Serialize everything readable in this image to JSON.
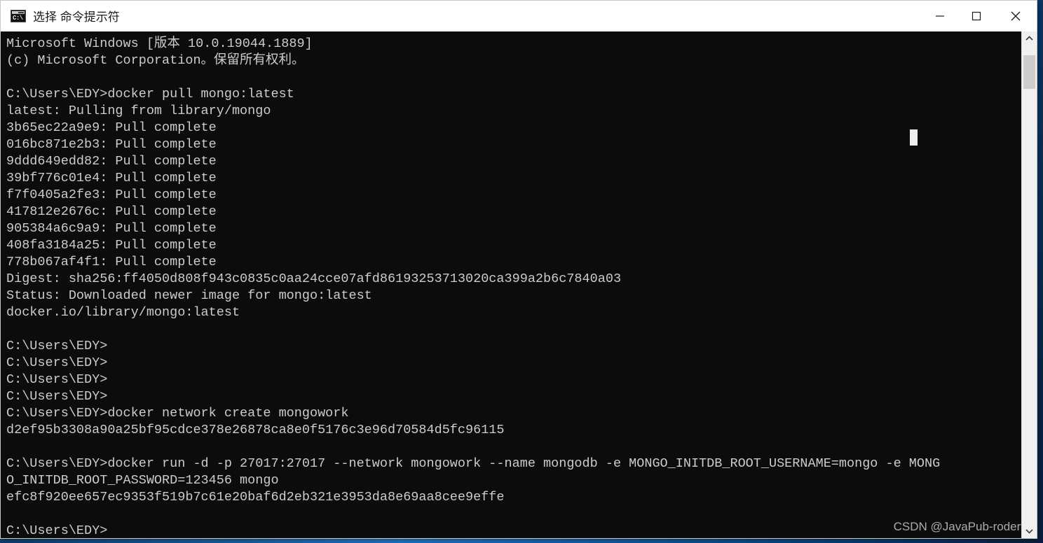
{
  "window": {
    "title": "选择 命令提示符",
    "icon": "cmd-icon",
    "icon_prompt_text": "C:\\",
    "controls": {
      "minimize_label": "─",
      "maximize_label": "□",
      "close_label": "✕"
    }
  },
  "console": {
    "background_color": "#0c0c0c",
    "foreground_color": "#cccccc",
    "cursor_color": "#eeeeee",
    "lines": [
      "Microsoft Windows [版本 10.0.19044.1889]",
      "(c) Microsoft Corporation。保留所有权利。",
      "",
      "C:\\Users\\EDY>docker pull mongo:latest",
      "latest: Pulling from library/mongo",
      "3b65ec22a9e9: Pull complete",
      "016bc871e2b3: Pull complete",
      "9ddd649edd82: Pull complete",
      "39bf776c01e4: Pull complete",
      "f7f0405a2fe3: Pull complete",
      "417812e2676c: Pull complete",
      "905384a6c9a9: Pull complete",
      "408fa3184a25: Pull complete",
      "778b067af4f1: Pull complete",
      "Digest: sha256:ff4050d808f943c0835c0aa24cce07afd86193253713020ca399a2b6c7840a03",
      "Status: Downloaded newer image for mongo:latest",
      "docker.io/library/mongo:latest",
      "",
      "C:\\Users\\EDY>",
      "C:\\Users\\EDY>",
      "C:\\Users\\EDY>",
      "C:\\Users\\EDY>",
      "C:\\Users\\EDY>docker network create mongowork",
      "d2ef95b3308a90a25bf95cdce378e26878ca8e0f5176c3e96d70584d5fc96115",
      "",
      "C:\\Users\\EDY>docker run -d -p 27017:27017 --network mongowork --name mongodb -e MONGO_INITDB_ROOT_USERNAME=mongo -e MONG",
      "O_INITDB_ROOT_PASSWORD=123456 mongo",
      "efc8f920ee657ec9353f519b7c61e20baf6d2eb321e3953da8e69aa8cee9effe",
      "",
      "C:\\Users\\EDY>"
    ]
  },
  "watermark": {
    "text": "CSDN @JavaPub-rodert"
  },
  "scrollbar": {
    "up_arrow": "⌃",
    "down_arrow": "⌄",
    "thumb_position_percent": 2,
    "thumb_size_percent": 7
  }
}
